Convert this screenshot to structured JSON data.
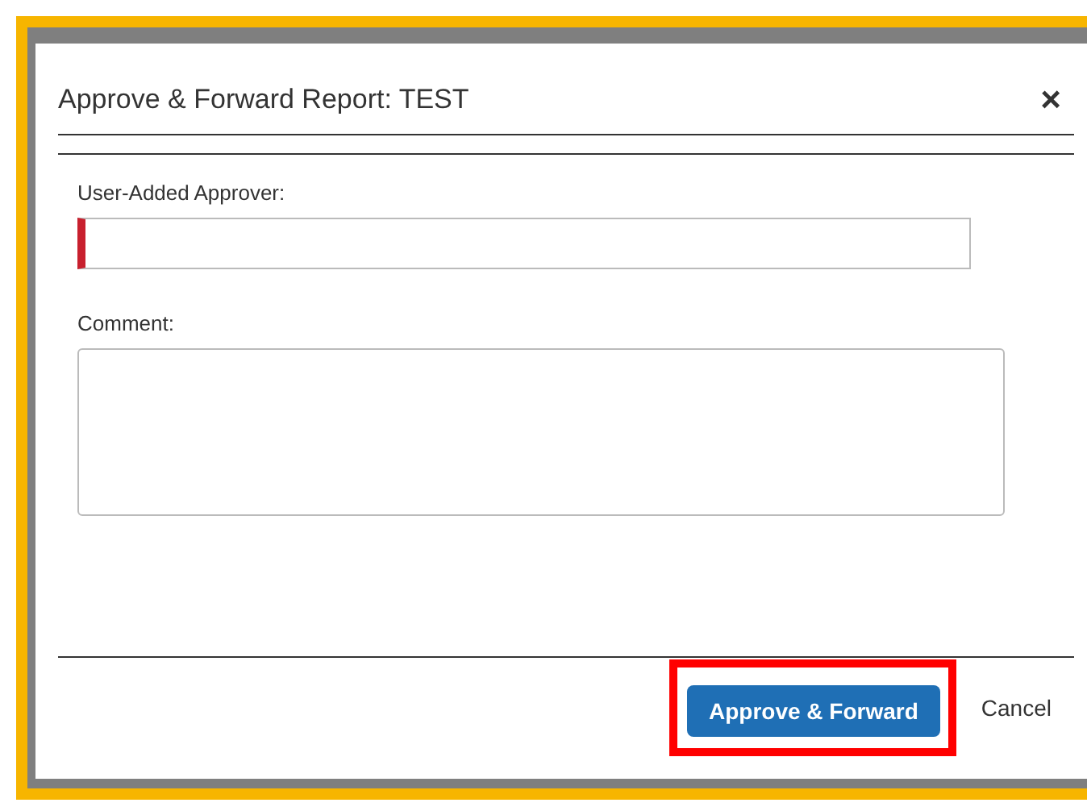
{
  "dialog": {
    "title": "Approve & Forward Report: TEST",
    "close": "×"
  },
  "fields": [
    {
      "label": "User-Added Approver:",
      "kind": "input",
      "required": true
    },
    {
      "label": "Comment:",
      "kind": "textarea",
      "required": false
    }
  ],
  "buttons": [
    {
      "label": "Approve & Forward",
      "kind": "primary",
      "highlighted": true
    },
    {
      "label": "Cancel",
      "kind": "link",
      "highlighted": false
    }
  ]
}
